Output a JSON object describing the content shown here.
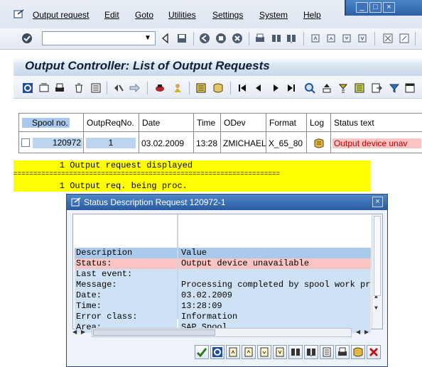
{
  "menubar": {
    "items": [
      "Output request",
      "Edit",
      "Goto",
      "Utilities",
      "Settings",
      "System",
      "Help"
    ]
  },
  "toolbar": {
    "command_field_value": ""
  },
  "screen": {
    "title": "Output Controller: List of Output Requests"
  },
  "table": {
    "headers": [
      "Spool no.",
      "OutpReqNo.",
      "Date",
      "Time",
      "ODev",
      "Format",
      "Log",
      "Status text"
    ],
    "row": {
      "spool_no": "120972",
      "outp_req_no": "1",
      "date": "03.02.2009",
      "time": "13:28",
      "odev": "ZMICHAEL",
      "format": "X_65_80",
      "status_text": "Output device unav"
    }
  },
  "messages": {
    "line1": "         1 Output request displayed",
    "separator": "===================================================================",
    "line2": "         1 Output req. being proc."
  },
  "dialog": {
    "title": "Status Description Request 120972-1",
    "header_key": "Description",
    "header_value": "Value",
    "rows": [
      {
        "key": "Status:",
        "value": "Output device unavailable"
      },
      {
        "key": "Last event:",
        "value": ""
      },
      {
        "key": "Message:",
        "value": "Processing completed by spool work pro"
      },
      {
        "key": "Date:",
        "value": "03.02.2009"
      },
      {
        "key": "Time:",
        "value": "13:28:09"
      },
      {
        "key": "Error class:",
        "value": "Information"
      },
      {
        "key": "Area:",
        "value": "SAP Spool"
      }
    ]
  },
  "colors": {
    "accent_blue": "#2a5aa1",
    "message_yellow": "#ffff00",
    "error_row": "#f8c4c4",
    "cell_blue": "#bcd4ee"
  }
}
